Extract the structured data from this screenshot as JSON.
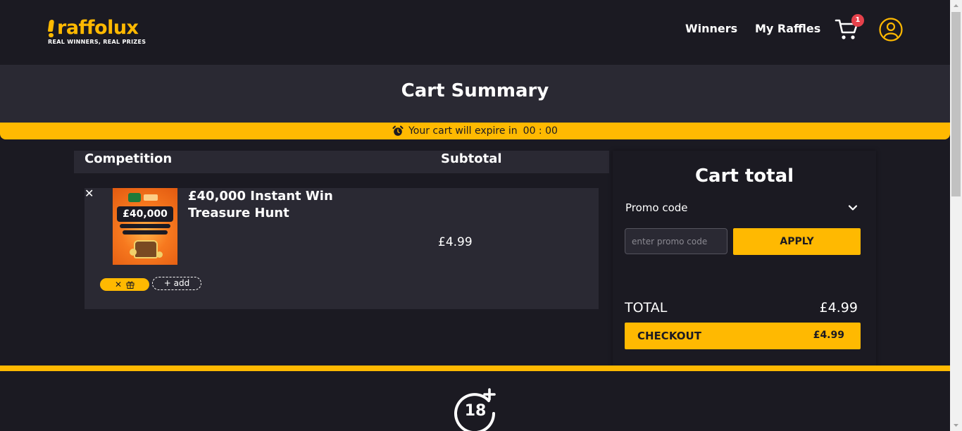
{
  "brand": {
    "name": "raffolux",
    "tagline": "REAL WINNERS, REAL PRIZES",
    "accent": "#ffb901",
    "dark": "#1b1a22",
    "panel": "#2a2933"
  },
  "nav": {
    "winners": "Winners",
    "my_raffles": "My Raffles",
    "cart_count": "1",
    "cart_icon": "cart-icon",
    "account_icon": "user-icon"
  },
  "page": {
    "title": "Cart Summary"
  },
  "expiry": {
    "text": "Your cart will expire in",
    "timer": "00 : 00",
    "icon": "alarm-clock-icon"
  },
  "table": {
    "headers": {
      "competition": "Competition",
      "subtotal": "Subtotal"
    },
    "items": [
      {
        "remove": "✕",
        "thumb_amount": "£40,000",
        "name": "£40,000 Instant Win Treasure Hunt",
        "price": "£4.99",
        "gift_remove": "✕",
        "gift_icon": "gift-icon",
        "add_label": "+ add"
      }
    ]
  },
  "cart_total": {
    "title": "Cart total",
    "promo_label": "Promo code",
    "promo_placeholder": "enter promo code",
    "promo_value": "",
    "apply_label": "APPLY",
    "total_label": "TOTAL",
    "total_value": "£4.99",
    "checkout_label": "CHECKOUT",
    "checkout_amount": "£4.99"
  },
  "footer": {
    "age_badge": "18"
  }
}
